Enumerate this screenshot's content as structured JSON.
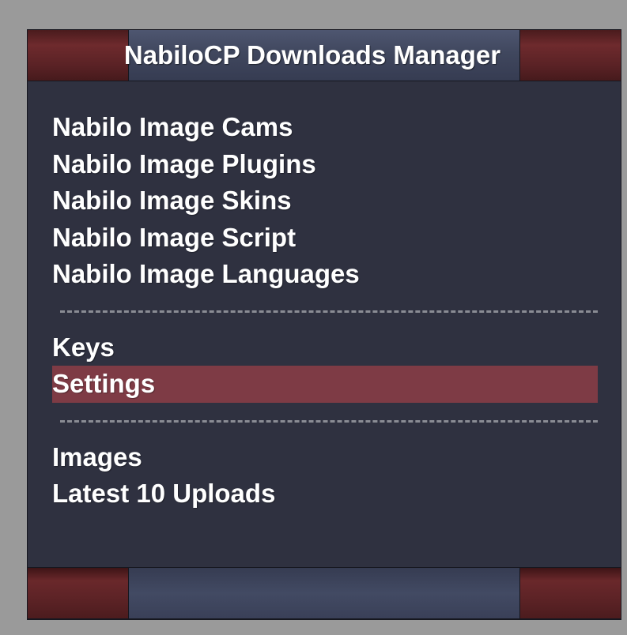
{
  "header": {
    "title": "NabiloCP Downloads Manager"
  },
  "menu": {
    "group1": [
      {
        "label": "Nabilo Image Cams"
      },
      {
        "label": "Nabilo Image Plugins"
      },
      {
        "label": "Nabilo Image Skins"
      },
      {
        "label": "Nabilo Image Script"
      },
      {
        "label": "Nabilo Image Languages"
      }
    ],
    "group2": [
      {
        "label": "Keys"
      },
      {
        "label": "Settings",
        "active": true
      }
    ],
    "group3": [
      {
        "label": "Images"
      },
      {
        "label": "Latest 10 Uploads"
      }
    ]
  },
  "colors": {
    "panel_background": "#2f3140",
    "active_item": "#7e3b45",
    "accent_red": "#6e2a2d",
    "accent_blue": "#40475e",
    "page_background": "#9a9a9a"
  }
}
